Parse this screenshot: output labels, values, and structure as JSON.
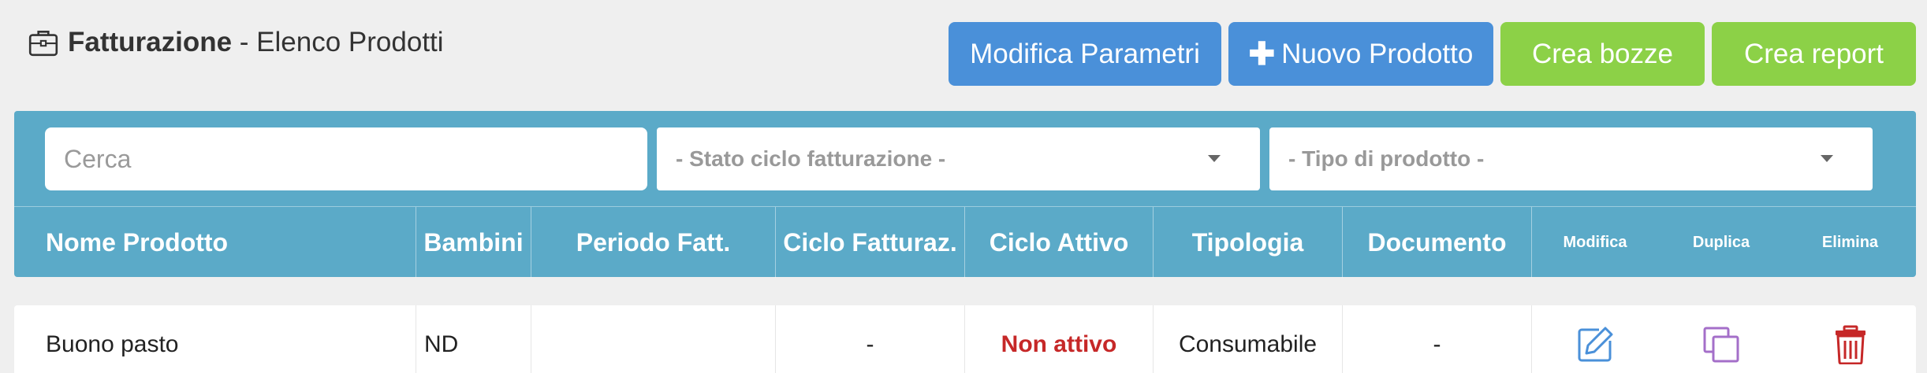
{
  "header": {
    "icon": "briefcase-icon",
    "title_strong": "Fatturazione",
    "title_rest": " - Elenco Prodotti"
  },
  "toolbar": {
    "edit_params_label": "Modifica Parametri",
    "new_product_label": "Nuovo Prodotto",
    "new_product_icon": "plus-icon",
    "drafts_label": "Crea bozze",
    "report_label": "Crea report",
    "colors": {
      "blue": "#4a90d9",
      "green": "#8cd147"
    }
  },
  "filters": {
    "search_placeholder": "Cerca",
    "search_value": "",
    "billing_cycle_state": "- Stato ciclo fatturazione -",
    "product_type": "- Tipo di prodotto -"
  },
  "table": {
    "header_color": "#5baac8",
    "columns": [
      "Nome Prodotto",
      "Bambini",
      "Periodo Fatt.",
      "Ciclo Fatturaz.",
      "Ciclo Attivo",
      "Tipologia",
      "Documento",
      "Modifica",
      "Duplica",
      "Elimina"
    ],
    "rows": [
      {
        "name": "Buono pasto",
        "children": "ND",
        "period": "",
        "cycle": "-",
        "active_cycle": "Non attivo",
        "active_cycle_color": "#c62828",
        "type": "Consumabile",
        "document": "-",
        "edit_icon": "edit-icon",
        "duplicate_icon": "duplicate-icon",
        "delete_icon": "trash-icon"
      }
    ]
  }
}
